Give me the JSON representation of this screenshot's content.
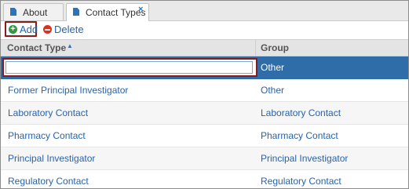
{
  "tabs": [
    {
      "label": "About",
      "icon": "document-icon"
    },
    {
      "label": "Contact Types",
      "icon": "document-icon",
      "close": "×",
      "active": true
    }
  ],
  "toolbar": {
    "add_label": "Add",
    "delete_label": "Delete"
  },
  "grid": {
    "columns": [
      "Contact Type",
      "Group"
    ],
    "sorted_column": "Contact Type",
    "sort_direction": "ascending",
    "edit_row": {
      "contact_type_value": "",
      "group": "Other"
    },
    "rows": [
      {
        "contact_type": "Former Principal Investigator",
        "group": "Other"
      },
      {
        "contact_type": "Laboratory Contact",
        "group": "Laboratory Contact"
      },
      {
        "contact_type": "Pharmacy Contact",
        "group": "Pharmacy Contact"
      },
      {
        "contact_type": "Principal Investigator",
        "group": "Principal Investigator"
      },
      {
        "contact_type": "Regulatory Contact",
        "group": "Regulatory Contact"
      }
    ]
  },
  "colors": {
    "accent": "#2e6da8",
    "link": "#2a63a8",
    "highlight_border": "#8b1b1b",
    "add_icon": "#2e9a3e",
    "delete_icon": "#d9301f"
  }
}
